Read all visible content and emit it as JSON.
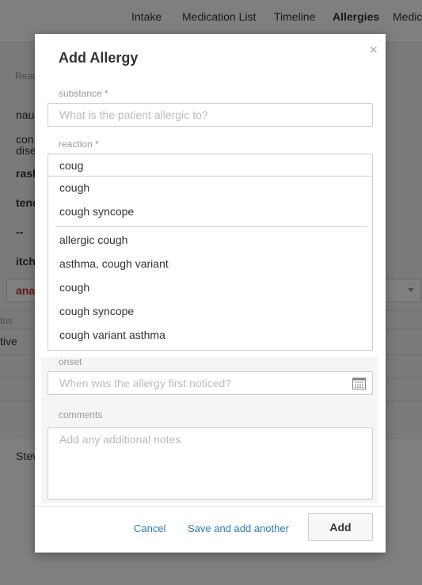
{
  "nav": {
    "tabs": [
      "Intake",
      "Medication List",
      "Timeline",
      "Allergies",
      "Medic"
    ]
  },
  "background": {
    "reaction_header": "Reac",
    "items": [
      "nau",
      "con",
      "dise",
      "rash",
      "tenc",
      "--",
      "itch"
    ],
    "selected_value": "ana",
    "status_header": "tus",
    "status_value": "tive",
    "footer_name": "Stev"
  },
  "modal": {
    "title": "Add Allergy",
    "close_glyph": "×",
    "substance": {
      "label": "substance *",
      "placeholder": "What is the patient allergic to?"
    },
    "reaction": {
      "label": "reaction *",
      "value": "coug",
      "suggestions_primary": [
        "cough",
        "cough syncope"
      ],
      "suggestions_secondary": [
        "allergic cough",
        "asthma, cough variant",
        "cough",
        "cough syncope",
        "cough variant asthma"
      ]
    },
    "onset": {
      "label": "onset",
      "placeholder": "When was the allergy first noticed?"
    },
    "comments": {
      "label": "comments",
      "placeholder": "Add any additional notes"
    },
    "footer": {
      "cancel_label": "Cancel",
      "save_another_label": "Save and add another",
      "add_label": "Add"
    }
  },
  "icons": {
    "close": "close-icon",
    "calendar": "calendar-icon",
    "caret": "chevron-down-icon"
  },
  "colors": {
    "link": "#2a7ab8",
    "overlay": "rgba(0,0,0,0.5)",
    "alert_text": "#c0392b"
  }
}
